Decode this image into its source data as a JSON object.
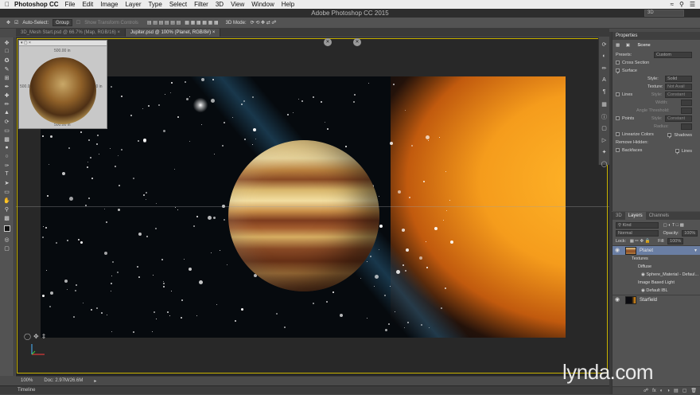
{
  "menubar": {
    "apple_icon": "apple-icon",
    "app_name": "Photoshop CC",
    "items": [
      "File",
      "Edit",
      "Image",
      "Layer",
      "Type",
      "Select",
      "Filter",
      "3D",
      "View",
      "Window",
      "Help"
    ]
  },
  "title_bar": {
    "title": "Adobe Photoshop CC 2015",
    "workspace": "3D"
  },
  "options_bar": {
    "auto_select_label": "Auto-Select:",
    "auto_select_value": "Group",
    "transform_controls_label": "Show Transform Controls",
    "mode_label": "3D Mode:"
  },
  "tabs": [
    {
      "label": "3D_Mesh Start.psd @ 66.7% (Map, RGB/16)",
      "active": false
    },
    {
      "label": "Jupiter.psd @ 100% (Planet, RGB/8#)",
      "active": true
    }
  ],
  "navigator": {
    "top_label": "500.00 in",
    "left_label": "500.00 in",
    "right_label": "500.00 in",
    "bottom_label": "500.00 in"
  },
  "status": {
    "zoom": "100%",
    "doc": "Doc: 2.97M/26.6M"
  },
  "timeline_label": "Timeline",
  "properties": {
    "tab": "Properties",
    "scene_label": "Scene",
    "presets_label": "Presets:",
    "presets_value": "Custom",
    "cross_section_label": "Cross Section",
    "surface_label": "Surface",
    "style_label": "Style:",
    "style_value": "Solid",
    "texture_label": "Texture:",
    "texture_value": "Not Avail",
    "lines_label": "Lines",
    "lines_style_label": "Style:",
    "lines_style_value": "Constant",
    "width_label": "Width:",
    "angle_label": "Angle Threshold:",
    "points_label": "Points",
    "points_style_label": "Style:",
    "points_style_value": "Constant",
    "radius_label": "Radius:",
    "linearize_label": "Linearize Colors",
    "shadows_label": "Shadows",
    "remove_hidden_label": "Remove Hidden:",
    "backfaces_label": "Backfaces",
    "lines_check_label": "Lines"
  },
  "layers_panel": {
    "tabs": [
      "3D",
      "Layers",
      "Channels"
    ],
    "kind_label": "Kind",
    "blend_mode": "Normal",
    "opacity_label": "Opacity:",
    "opacity_value": "100%",
    "lock_label": "Lock:",
    "fill_label": "Fill:",
    "fill_value": "100%",
    "layers": [
      {
        "name": "Planet",
        "selected": true
      },
      {
        "name": "Starfield",
        "selected": false
      }
    ],
    "sublayers": [
      "Textures",
      "Diffuse",
      "Sphere_Material - Defaul...",
      "Image Based Light",
      "Default IBL"
    ]
  },
  "watermark": "lynda.com",
  "colors": {
    "accent_frame": "#c9b300",
    "selected_layer": "#6a7ea3",
    "glow": "#f59c1c"
  }
}
